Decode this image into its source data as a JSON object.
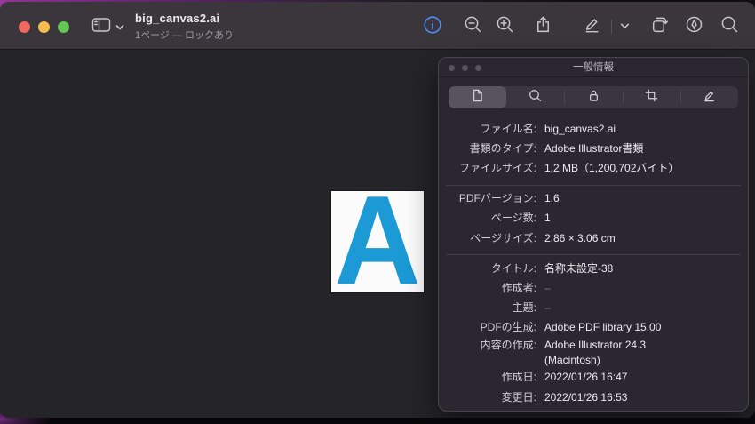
{
  "window": {
    "title": "big_canvas2.ai",
    "subtitle": "1ページ — ロックあり"
  },
  "toolbar": {
    "icons": [
      "sidebar",
      "info",
      "zoom-out",
      "zoom-in",
      "share",
      "markup",
      "chevron-down",
      "rotate",
      "highlight",
      "search"
    ]
  },
  "document": {
    "letter": "A"
  },
  "panel": {
    "title": "一般情報",
    "tabs": [
      "general-info",
      "more-info",
      "lock",
      "crop",
      "annotations"
    ],
    "rows": [
      {
        "label": "ファイル名:",
        "value": "big_canvas2.ai"
      },
      {
        "label": "書類のタイプ:",
        "value": "Adobe Illustrator書類"
      },
      {
        "label": "ファイルサイズ:",
        "value": "1.2 MB（1,200,702バイト）"
      },
      {
        "label": "PDFバージョン:",
        "value": "1.6"
      },
      {
        "label": "ページ数:",
        "value": "1"
      },
      {
        "label": "ページサイズ:",
        "value": "2.86 × 3.06 cm"
      },
      {
        "label": "タイトル:",
        "value": "名称未設定-38"
      },
      {
        "label": "作成者:",
        "value": "–"
      },
      {
        "label": "主題:",
        "value": "–"
      },
      {
        "label": "PDFの生成:",
        "value": "Adobe PDF library 15.00"
      },
      {
        "label": "内容の作成:",
        "value": "Adobe Illustrator 24.3\n(Macintosh)"
      },
      {
        "label": "作成日:",
        "value": "2022/01/26 16:47"
      },
      {
        "label": "変更日:",
        "value": "2022/01/26 16:53"
      }
    ]
  },
  "colors": {
    "accent_blue": "#4f8bf7",
    "letter_blue": "#1b9ad6",
    "traffic_red": "#ee6a5f",
    "traffic_yellow": "#f5be4f",
    "traffic_green": "#62c554"
  }
}
